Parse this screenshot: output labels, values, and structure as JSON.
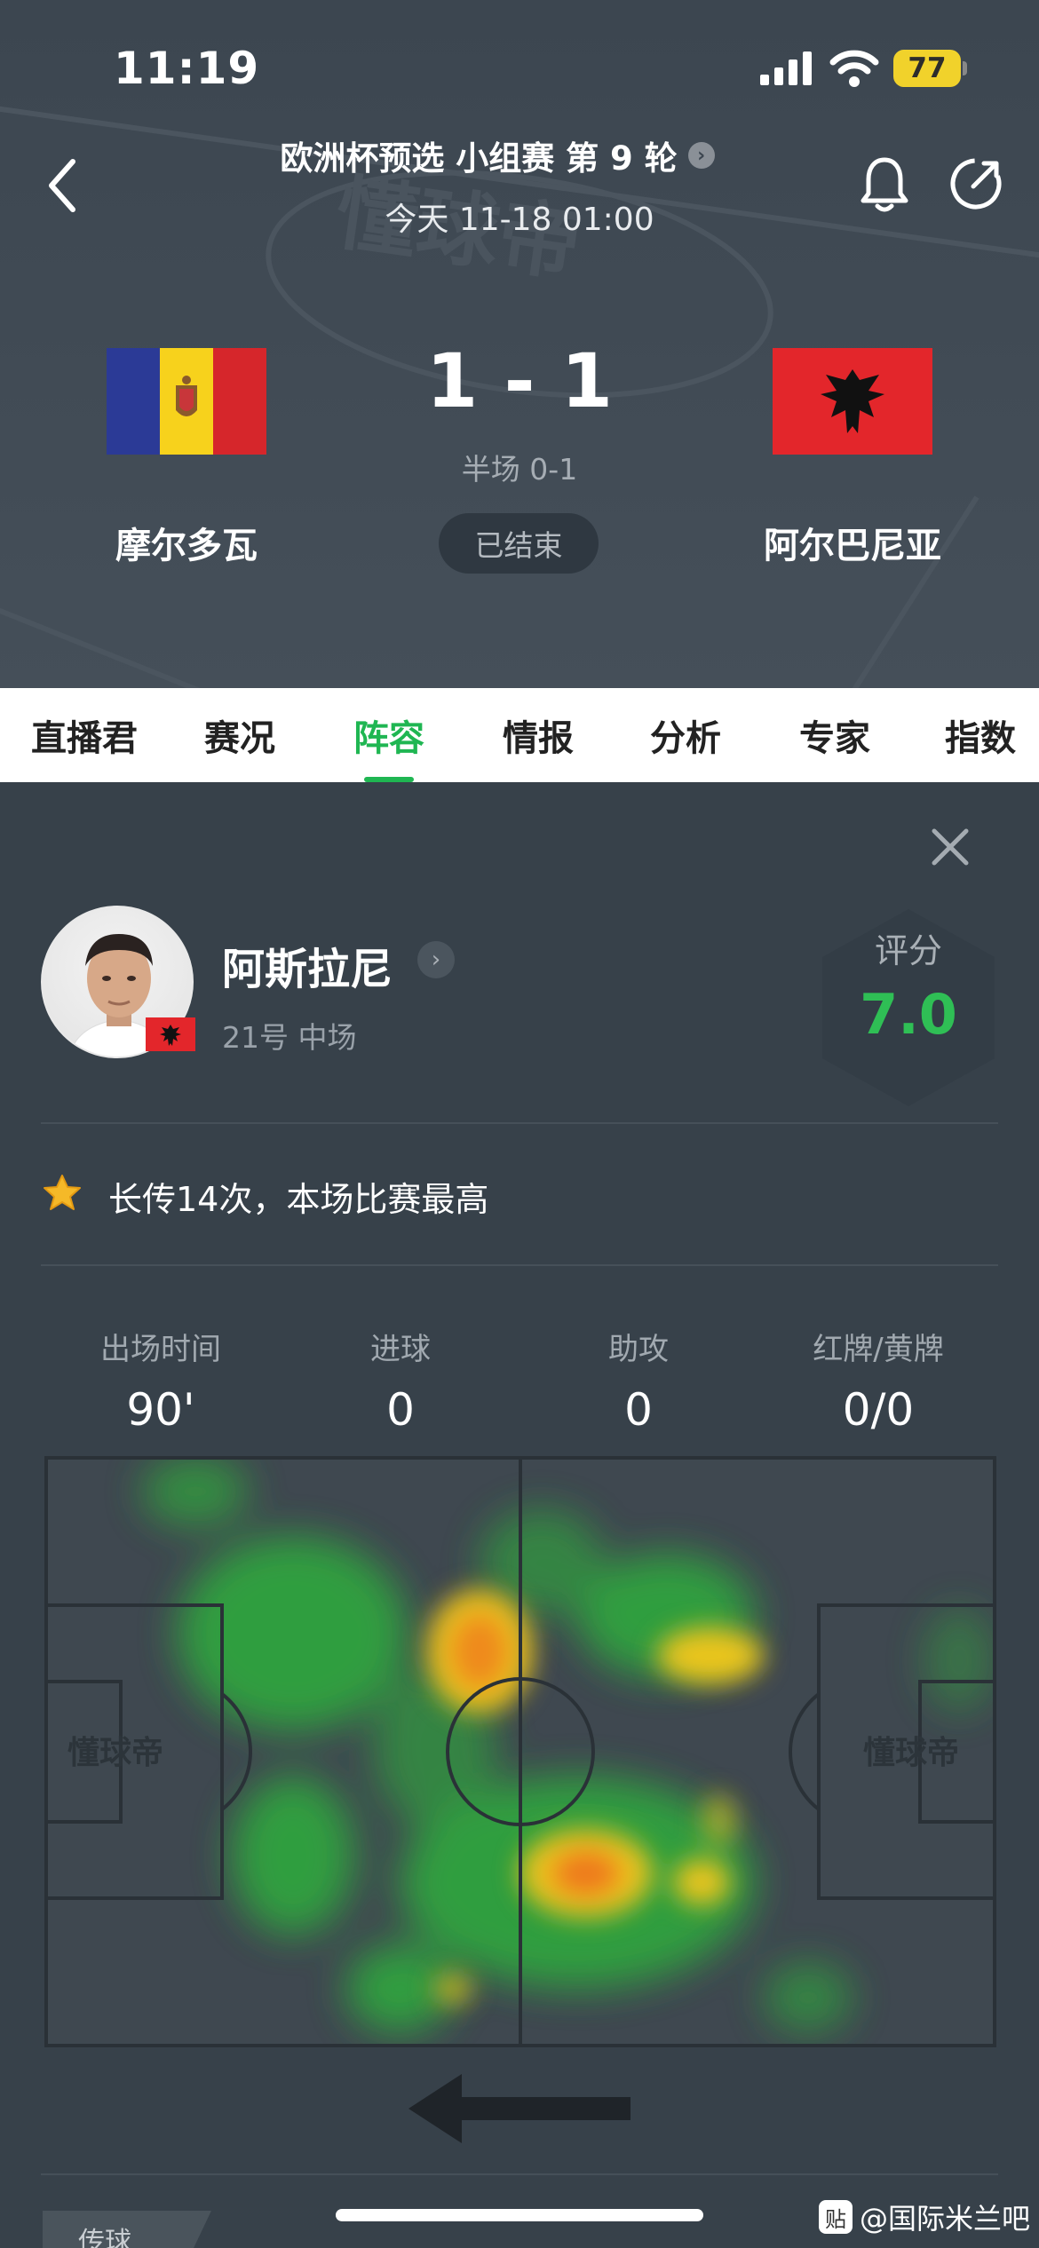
{
  "status_bar": {
    "time": "11:19",
    "battery": "77"
  },
  "header": {
    "title": "欧洲杯预选 小组赛 第 9 轮",
    "title_chevron": "›",
    "datetime": "今天 11-18 01:00",
    "home_team": "摩尔多瓦",
    "away_team": "阿尔巴尼亚",
    "score": "1 - 1",
    "halftime": "半场 0-1",
    "status": "已结束",
    "watermark": "懂球帝"
  },
  "tabs": [
    {
      "label": "直播君",
      "active": false
    },
    {
      "label": "赛况",
      "active": false
    },
    {
      "label": "阵容",
      "active": true
    },
    {
      "label": "情报",
      "active": false
    },
    {
      "label": "分析",
      "active": false
    },
    {
      "label": "专家",
      "active": false
    },
    {
      "label": "指数",
      "active": false
    }
  ],
  "player": {
    "name": "阿斯拉尼",
    "chevron": "›",
    "meta": "21号 中场",
    "rating_label": "评分",
    "rating_value": "7.0",
    "highlight": "长传14次，本场比赛最高"
  },
  "stats": [
    {
      "label": "出场时间",
      "value": "90'"
    },
    {
      "label": "进球",
      "value": "0"
    },
    {
      "label": "助攻",
      "value": "0"
    },
    {
      "label": "红牌/黄牌",
      "value": "0/0"
    }
  ],
  "pitch": {
    "left_mark": "懂球帝",
    "right_mark": "懂球帝"
  },
  "footer": {
    "tag": "传球",
    "watermark": "@国际米兰吧",
    "watermark_icon": "贴"
  },
  "colors": {
    "accent": "#1fb652",
    "rating": "#2fbf55",
    "battery": "#f1d22b"
  },
  "icons": [
    "back-icon",
    "bell-icon",
    "share-icon",
    "close-icon",
    "star-icon",
    "arrow-left-icon",
    "signal-icon",
    "wifi-icon"
  ]
}
